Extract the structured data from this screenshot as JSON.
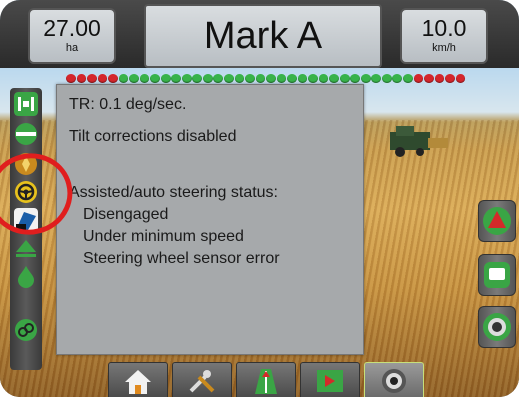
{
  "top_bar": {
    "left_value": "27.00",
    "left_unit": "ha",
    "title": "Mark A",
    "right_value": "10.0",
    "right_unit": "km/h"
  },
  "lightbar": {
    "leds": [
      "red",
      "red",
      "red",
      "red",
      "red",
      "green",
      "green",
      "green",
      "green",
      "green",
      "green",
      "green",
      "green",
      "green",
      "green",
      "green",
      "green",
      "green",
      "green",
      "green",
      "green",
      "green",
      "green",
      "green",
      "green",
      "green",
      "green",
      "green",
      "green",
      "green",
      "green",
      "green",
      "green",
      "red",
      "red",
      "red",
      "red",
      "red"
    ]
  },
  "info_panel": {
    "tilt_rate": "TR: 0.1 deg/sec.",
    "tilt_status": "Tilt corrections disabled",
    "steering_heading": "Assisted/auto steering status:",
    "status_lines": [
      "Disengaged",
      "Under minimum speed",
      "Steering wheel sensor error"
    ]
  },
  "left_toolbar": {
    "icons": [
      "section-status-icon",
      "boom-icon",
      "tilt-module-icon",
      "steering-wheel-icon",
      "steering-sensor-icon",
      "guidance-mode-icon",
      "liquid-drop-icon",
      "connection-icon"
    ]
  },
  "right_toolbar": {
    "icons": [
      "guidance-triangle-icon",
      "map-flag-icon",
      "camera-lens-icon"
    ]
  },
  "bottom_nav": {
    "items": [
      "home-icon",
      "tools-icon",
      "guidance-view-icon",
      "map-icon",
      "camera-icon"
    ]
  },
  "colors": {
    "annotation": "#e01e1e",
    "led_red": "#d4262c",
    "led_green": "#38b34a",
    "accent_green": "#3aa545",
    "panel_bg": "#a6a9ab"
  }
}
